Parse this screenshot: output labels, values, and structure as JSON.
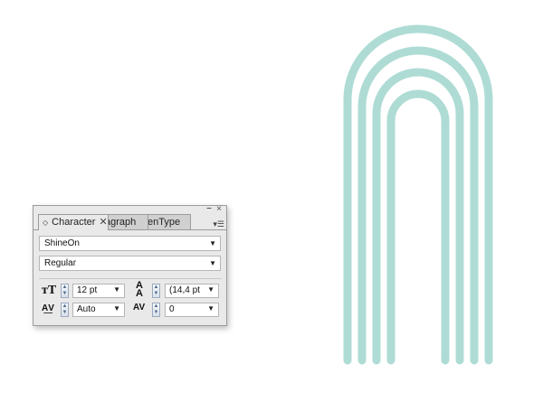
{
  "artwork": {
    "stroke_color": "#aedcd5",
    "icon": "neon-arch-lines"
  },
  "panel": {
    "tabs": [
      {
        "label": "Character",
        "active": true
      },
      {
        "label": "agraph"
      },
      {
        "label": "enType"
      }
    ],
    "font_family": "ShineOn",
    "font_style": "Regular",
    "font_size": "12 pt",
    "leading": "(14,4 pt",
    "kerning": "Auto",
    "tracking": "0"
  }
}
